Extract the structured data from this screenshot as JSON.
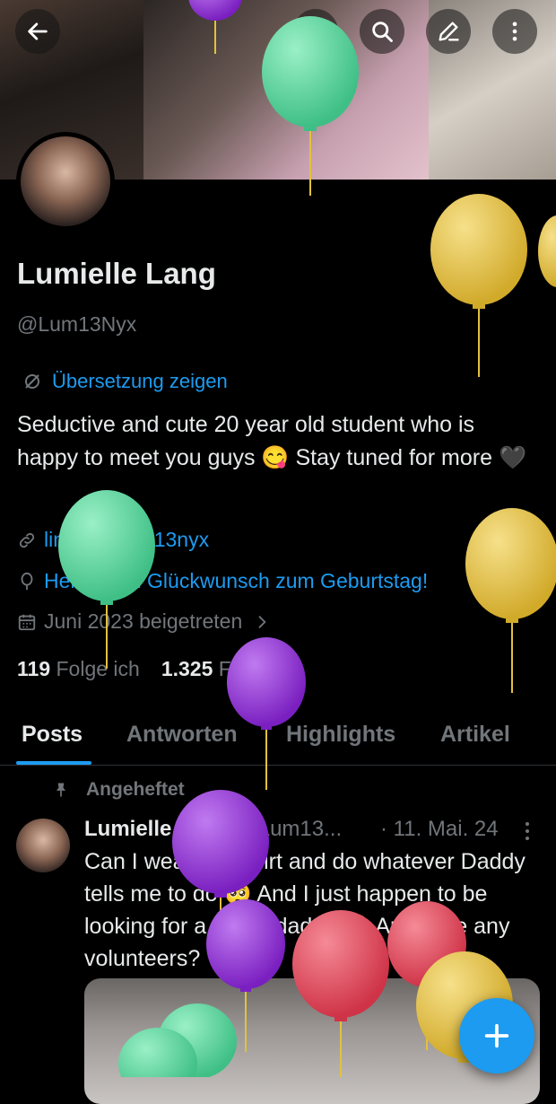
{
  "profile": {
    "name": "Lumielle Lang",
    "handle": "@Lum13Nyx",
    "translate_label": "Übersetzung zeigen",
    "bio": "Seductive and cute 20 year old student who is happy to meet you guys 😋 Stay tuned for more 🖤",
    "link": "linktr.ee/lum13nyx",
    "birthday": "Herzlichen Glückwunsch zum Geburtstag!",
    "joined": "Juni 2023 beigetreten",
    "following_count": "119",
    "following_label": "Folge ich",
    "followers_count": "1.325",
    "followers_label": "Follower"
  },
  "toolbar": {
    "back_icon": "arrow-left-icon",
    "translate_icon": "translate-icon",
    "search_icon": "search-icon",
    "edit_icon": "edit-icon",
    "more_icon": "more-vertical-icon"
  },
  "tabs": [
    {
      "label": "Posts",
      "active": true
    },
    {
      "label": "Antworten",
      "active": false
    },
    {
      "label": "Highlights",
      "active": false
    },
    {
      "label": "Artikel",
      "active": false
    }
  ],
  "post": {
    "pinned_label": "Angeheftet",
    "author_name": "Lumielle Lang",
    "author_handle": "@Lum13...",
    "date": "· 11. Mai. 24",
    "text": "Can I wear this shirt and do whatever Daddy tells me to do 🥺 And I just happen to be looking for a sugar daddy 🤭 Are there any volunteers?"
  },
  "colors": {
    "accent": "#1d9bf0",
    "muted": "#71767b",
    "background": "#000000",
    "balloon_green": "#4fd39a",
    "balloon_yellow": "#e3c13d",
    "balloon_purple": "#8e2bd2",
    "balloon_red": "#e04a5c"
  }
}
